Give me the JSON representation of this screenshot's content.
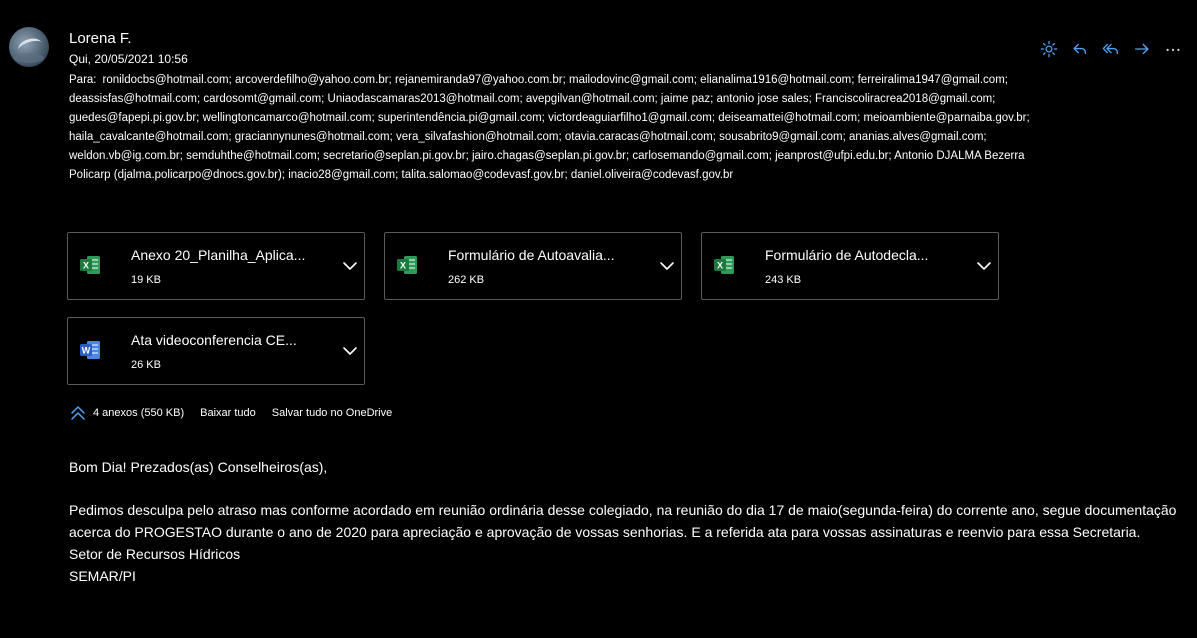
{
  "message": {
    "sender": "Lorena F.",
    "date": "Qui, 20/05/2021 10:56",
    "to_label": "Para:",
    "recipients": "ronildocbs@hotmail.com; arcoverdefilho@yahoo.com.br; rejanemiranda97@yahoo.com.br; mailodovinc@gmail.com; elianalima1916@hotmail.com; ferreiralima1947@gmail.com; deassisfas@hotmail.com; cardosomt@gmail.com; Uniaodascamaras2013@hotmail.com; avepgilvan@hotmail.com; jaime paz; antonio jose sales; Franciscoliracrea2018@gmail.com; guedes@fapepi.pi.gov.br; wellingtoncamarco@hotmail.com; superintendência.pi@gmail.com; victordeaguiarfilho1@gmail.com; deiseamattei@hotmail.com; meioambiente@parnaiba.gov.br; haila_cavalcante@hotmail.com; graciannynunes@hotmail.com; vera_silvafashion@hotmail.com; otavia.caracas@hotmail.com; sousabrito9@gmail.com; ananias.alves@gmail.com; weldon.vb@ig.com.br; semduhthe@hotmail.com; secretario@seplan.pi.gov.br; jairo.chagas@seplan.pi.gov.br; carlosemando@gmail.com; jeanprost@ufpi.edu.br; Antonio DJALMA Bezerra Policarp (djalma.policarpo@dnocs.gov.br); inacio28@gmail.com; talita.salomao@codevasf.gov.br; daniel.oliveira@codevasf.gov.br"
  },
  "toolbar": {
    "icons": [
      "sun-icon",
      "reply-icon",
      "reply-all-icon",
      "forward-icon",
      "more-icon"
    ]
  },
  "attachments": [
    {
      "name": "Anexo 20_Planilha_Aplica...",
      "size": "19 KB",
      "type": "excel"
    },
    {
      "name": "Formulário de Autoavalia...",
      "size": "262 KB",
      "type": "excel"
    },
    {
      "name": "Formulário de Autodecla...",
      "size": "243 KB",
      "type": "excel"
    },
    {
      "name": "Ata videoconferencia CE...",
      "size": "26 KB",
      "type": "word"
    }
  ],
  "attachments_summary": {
    "count": "4 anexos (550 KB)",
    "download_all": "Baixar tudo",
    "save_onedrive": "Salvar tudo no OneDrive"
  },
  "body": {
    "greeting": "Bom Dia! Prezados(as) Conselheiros(as),",
    "paragraph": "Pedimos desculpa pelo atraso mas conforme acordado em reunião ordinária  desse colegiado, na reunião do dia 17 de maio(segunda-feira)  do corrente ano, segue documentação acerca do PROGESTAO durante o ano de 2020 para apreciação e aprovação de vossas senhorias.  E a  referida ata para vossas assinaturas e reenvio para essa Secretaria.",
    "signature_line1": "Setor de Recursos Hídricos",
    "signature_line2": "SEMAR/PI"
  },
  "colors": {
    "background": "#000000",
    "accent": "#4fa3f0",
    "excel": "#1d7a3e",
    "word": "#2b5fc7"
  }
}
